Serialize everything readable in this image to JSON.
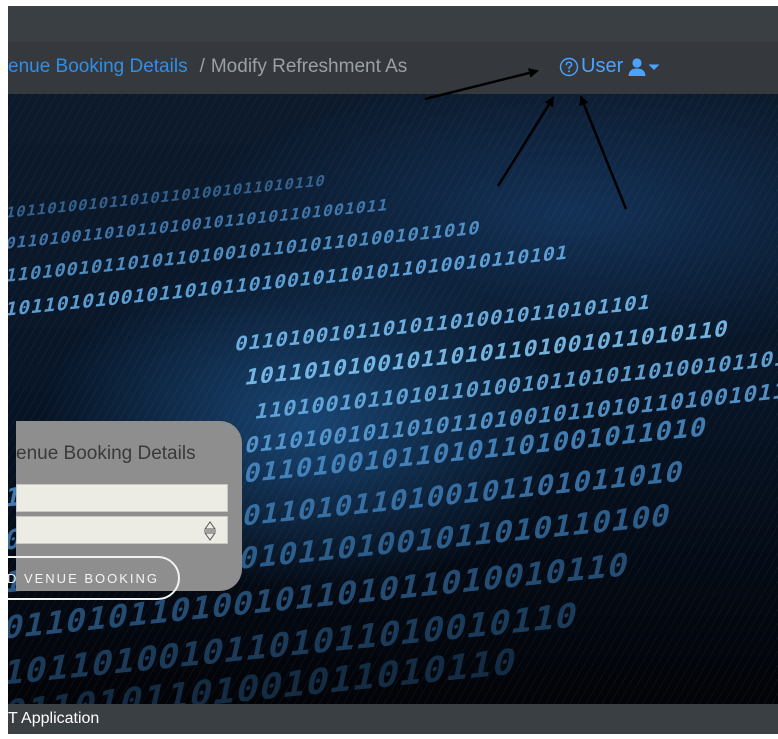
{
  "navbar": {
    "breadcrumb_link": "enue Booking Details",
    "breadcrumb_separator": "/",
    "breadcrumb_current": "Modify Refreshment As",
    "user_label": "User"
  },
  "icons": {
    "help": "question-circle-icon",
    "user": "user-icon",
    "caret": "caret-down-icon",
    "spinner": "spinner-arrows-icon"
  },
  "card": {
    "title": "enue Booking Details",
    "button_label": "D VENUE BOOKING"
  },
  "footer": {
    "text": "T Application"
  },
  "colors": {
    "link": "#2f8fe6",
    "navbar": "#35393d",
    "card": "#8e8e8e",
    "footer": "#3a3f44"
  }
}
